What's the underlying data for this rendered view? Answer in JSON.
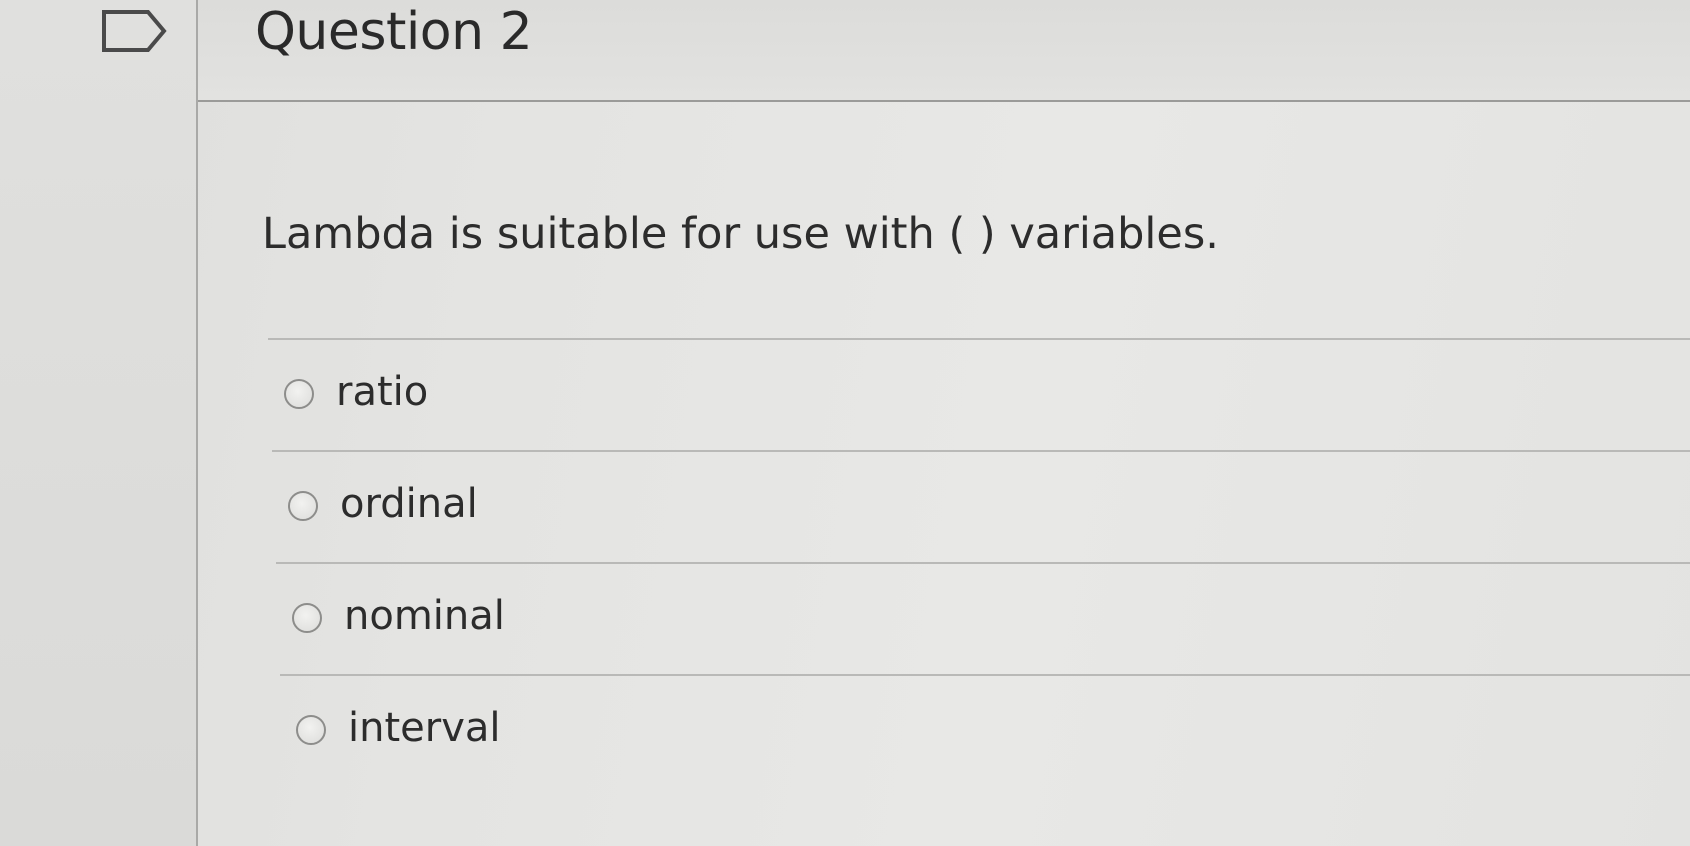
{
  "header": {
    "title": "Question 2",
    "flag_icon": "flag-outline-icon"
  },
  "question": {
    "text": "Lambda is suitable for use with ( ) variables."
  },
  "answers": [
    {
      "label": "ratio",
      "selected": false
    },
    {
      "label": "ordinal",
      "selected": false
    },
    {
      "label": "nominal",
      "selected": false
    },
    {
      "label": "interval",
      "selected": false
    }
  ],
  "colors": {
    "background": "#e4e4e2",
    "text": "#2c2c2c",
    "divider": "#b9b9b7",
    "radio_border": "#8d8d8b"
  }
}
